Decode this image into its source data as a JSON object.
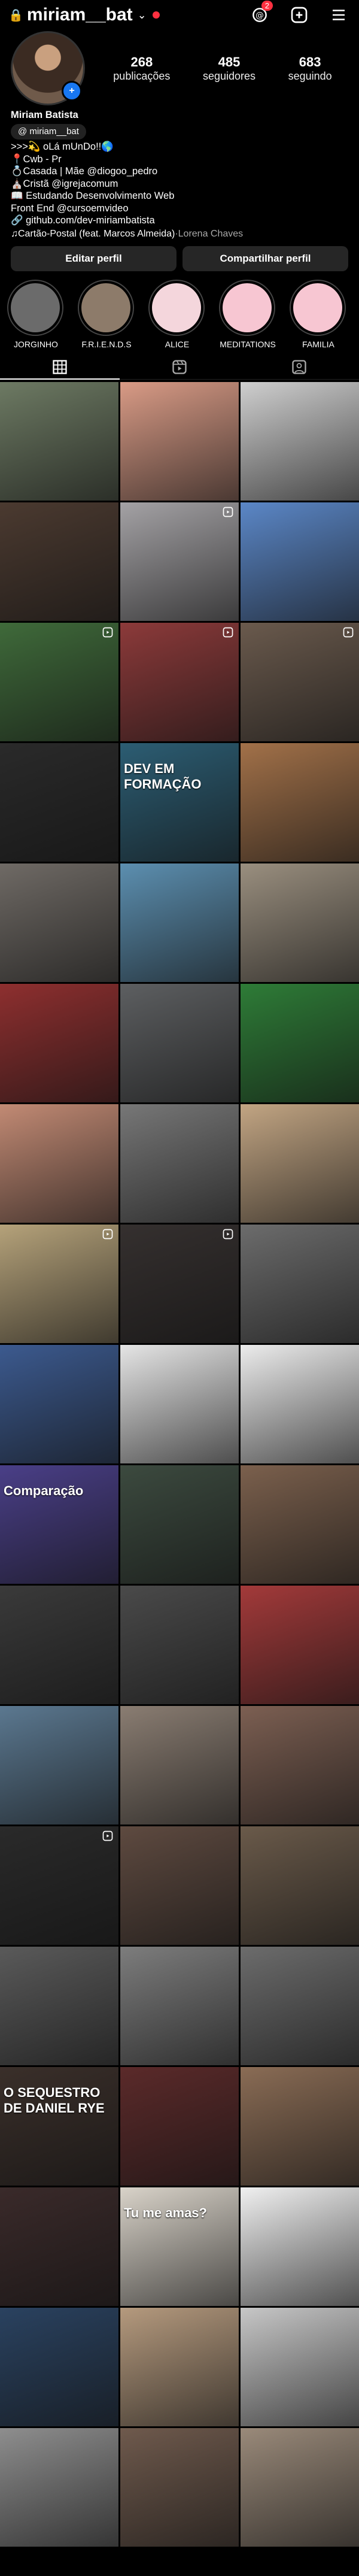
{
  "header": {
    "username": "miriam__bat",
    "notif_count": "2"
  },
  "profile": {
    "posts": "268",
    "posts_label": "publicações",
    "followers": "485",
    "followers_label": "seguidores",
    "following": "683",
    "following_label": "seguindo"
  },
  "bio": {
    "name": "Miriam Batista",
    "threads": "miriam__bat",
    "lines": [
      ">>>💫 oLá mUnDo!!🌎",
      "📍Cwb - Pr",
      "💍Casada | Mãe @diogoo_pedro",
      "⛪Cristã @igrejacomum",
      "📖 Estudando Desenvolvimento Web",
      "Front End @cursoemvideo"
    ],
    "link": "github.com/dev-miriambatista",
    "music_title": "Cartão-Postal (feat. Marcos Almeida)",
    "music_sep": " · ",
    "music_artist": "Lorena Chaves"
  },
  "buttons": {
    "edit": "Editar perfil",
    "share": "Compartilhar perfil"
  },
  "highlights": [
    {
      "label": "JORGINHO",
      "color": "#6b6b6b"
    },
    {
      "label": "F.R.I.E.N.D.S",
      "color": "#8d7b6a"
    },
    {
      "label": "ALICE",
      "color": "#f4d6dc"
    },
    {
      "label": "MEDITATIONS",
      "color": "#f7c6d2"
    },
    {
      "label": "FAMILIA",
      "color": "#f7c6d2"
    }
  ],
  "grid": [
    {
      "color": "#6d7a63",
      "reel": false,
      "text": ""
    },
    {
      "color": "#d99b86",
      "reel": false,
      "text": ""
    },
    {
      "color": "#cfcfcf",
      "reel": false,
      "text": ""
    },
    {
      "color": "#4b3a30",
      "reel": false,
      "text": ""
    },
    {
      "color": "#a4a2a5",
      "reel": true,
      "text": ""
    },
    {
      "color": "#5b87c7",
      "reel": false,
      "text": ""
    },
    {
      "color": "#3f6a3a",
      "reel": true,
      "text": ""
    },
    {
      "color": "#8c3a3a",
      "reel": true,
      "text": ""
    },
    {
      "color": "#6a5a4d",
      "reel": true,
      "text": ""
    },
    {
      "color": "#2a2a2a",
      "reel": false,
      "text": ""
    },
    {
      "color": "#2c5d73",
      "reel": false,
      "text": "DEV EM FORMAÇÃO"
    },
    {
      "color": "#a27149",
      "reel": false,
      "text": ""
    },
    {
      "color": "#6f6a65",
      "reel": false,
      "text": ""
    },
    {
      "color": "#5c8fb0",
      "reel": false,
      "text": ""
    },
    {
      "color": "#9a8f7f",
      "reel": false,
      "text": ""
    },
    {
      "color": "#8e2f2f",
      "reel": false,
      "text": ""
    },
    {
      "color": "#5d5f61",
      "reel": false,
      "text": ""
    },
    {
      "color": "#2e7c37",
      "reel": false,
      "text": ""
    },
    {
      "color": "#c28a74",
      "reel": false,
      "text": ""
    },
    {
      "color": "#777777",
      "reel": false,
      "text": ""
    },
    {
      "color": "#c2a583",
      "reel": false,
      "text": ""
    },
    {
      "color": "#b5a27a",
      "reel": true,
      "text": ""
    },
    {
      "color": "#35302f",
      "reel": true,
      "text": ""
    },
    {
      "color": "#6c6c6c",
      "reel": false,
      "text": ""
    },
    {
      "color": "#3c5a8f",
      "reel": false,
      "text": ""
    },
    {
      "color": "#e5e5e5",
      "reel": false,
      "text": ""
    },
    {
      "color": "#ececec",
      "reel": false,
      "text": ""
    },
    {
      "color": "#4a3f88",
      "reel": false,
      "text": "Comparação"
    },
    {
      "color": "#3c4a3f",
      "reel": false,
      "text": ""
    },
    {
      "color": "#7b604d",
      "reel": false,
      "text": ""
    },
    {
      "color": "#3a3a3a",
      "reel": false,
      "text": ""
    },
    {
      "color": "#4a4a4a",
      "reel": false,
      "text": ""
    },
    {
      "color": "#a33a3a",
      "reel": false,
      "text": ""
    },
    {
      "color": "#5b7890",
      "reel": false,
      "text": ""
    },
    {
      "color": "#8a7d72",
      "reel": false,
      "text": ""
    },
    {
      "color": "#7c5f52",
      "reel": false,
      "text": ""
    },
    {
      "color": "#2a2a2a",
      "reel": true,
      "text": ""
    },
    {
      "color": "#5e4a40",
      "reel": false,
      "text": ""
    },
    {
      "color": "#6a5a4a",
      "reel": false,
      "text": ""
    },
    {
      "color": "#5a5a5a",
      "reel": false,
      "text": ""
    },
    {
      "color": "#7d7d7d",
      "reel": false,
      "text": ""
    },
    {
      "color": "#6c6c6c",
      "reel": false,
      "text": ""
    },
    {
      "color": "#3a2f2a",
      "reel": false,
      "text": "O SEQUESTRO DE DANIEL RYE"
    },
    {
      "color": "#5b2a2a",
      "reel": false,
      "text": ""
    },
    {
      "color": "#8a6c55",
      "reel": false,
      "text": ""
    },
    {
      "color": "#3a2a2a",
      "reel": false,
      "text": ""
    },
    {
      "color": "#d9d3c9",
      "reel": false,
      "text": "Tu me amas?"
    },
    {
      "color": "#f0f0f0",
      "reel": false,
      "text": ""
    },
    {
      "color": "#2a4260",
      "reel": false,
      "text": ""
    },
    {
      "color": "#b59a7e",
      "reel": false,
      "text": ""
    },
    {
      "color": "#c7c7c7",
      "reel": false,
      "text": ""
    },
    {
      "color": "#8e8e8e",
      "reel": false,
      "text": ""
    },
    {
      "color": "#6f5a4d",
      "reel": false,
      "text": ""
    },
    {
      "color": "#9a8a7a",
      "reel": false,
      "text": ""
    }
  ]
}
